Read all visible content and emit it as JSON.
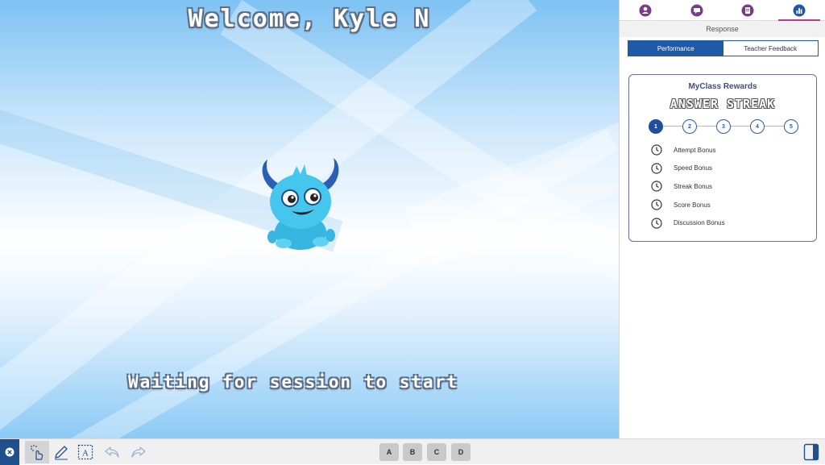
{
  "stage": {
    "welcome": "Welcome, Kyle N",
    "status": "Waiting for session to start"
  },
  "panel": {
    "tabs": [
      {
        "icon": "person-icon"
      },
      {
        "icon": "chat-icon"
      },
      {
        "icon": "document-icon"
      },
      {
        "icon": "bar-chart-icon",
        "active": true
      }
    ],
    "response_label": "Response",
    "segments": {
      "performance": "Performance",
      "teacher_feedback": "Teacher Feedback",
      "selected": "Performance"
    },
    "rewards": {
      "title": "MyClass Rewards",
      "streak_title": "ANSWER STREAK",
      "steps": [
        "1",
        "2",
        "3",
        "4",
        "5"
      ],
      "current_step": 1,
      "bonuses": [
        "Attempt Bonus",
        "Speed Bonus",
        "Streak Bonus",
        "Score Bonus",
        "Discussion Bonus"
      ]
    }
  },
  "toolbar": {
    "tools": [
      "close-icon",
      "select-hand-icon",
      "pen-icon",
      "text-box-icon",
      "undo-icon",
      "redo-icon"
    ],
    "choices": [
      "A",
      "B",
      "C",
      "D"
    ],
    "panel_toggle_icon": "sidebar-toggle-icon"
  },
  "colors": {
    "accent_blue": "#1f5aa8",
    "tab_underline": "#b73c8a",
    "close_button": "#1f4f8c"
  }
}
